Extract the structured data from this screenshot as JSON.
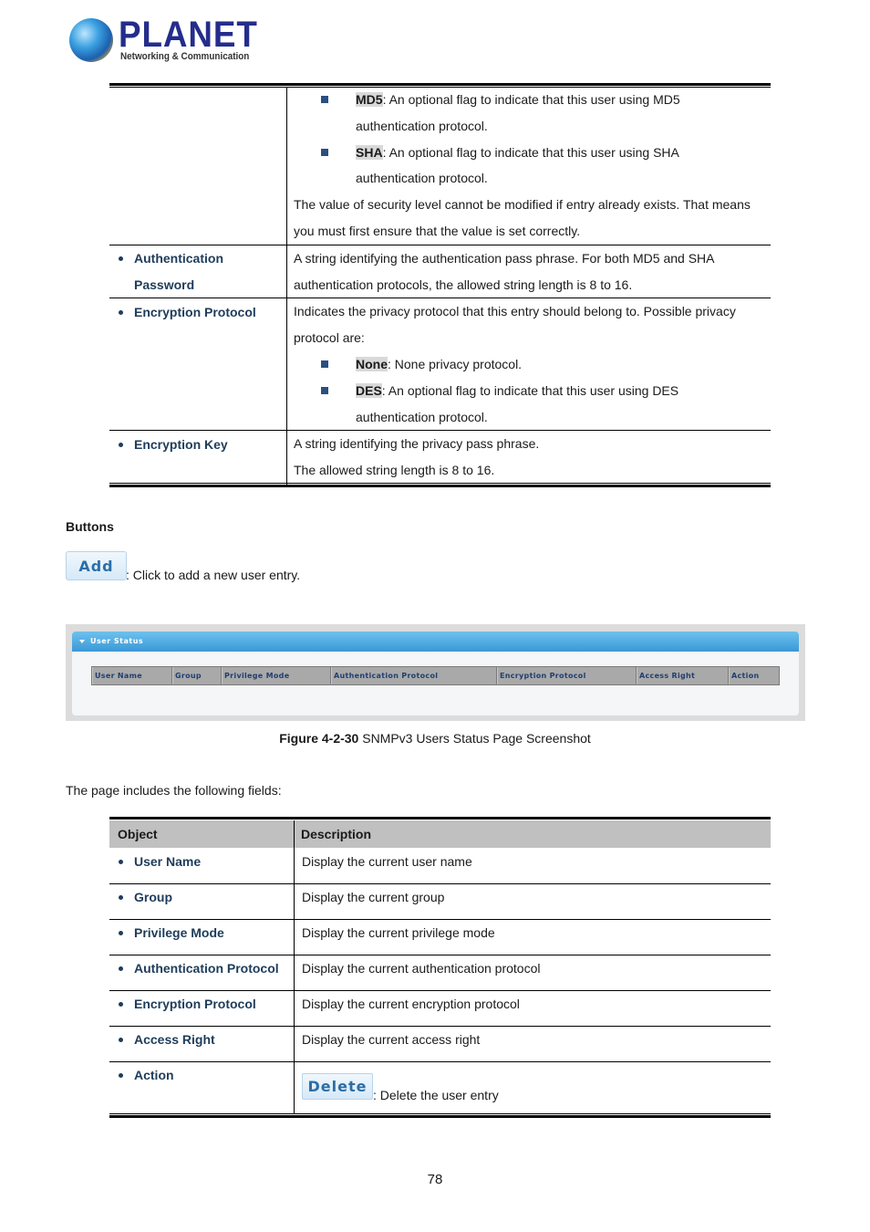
{
  "logo": {
    "brand": "PLANET",
    "tagline": "Networking & Communication"
  },
  "table1": {
    "continued_row": {
      "items": [
        {
          "flag": "MD5",
          "text": ": An optional flag to indicate that this user using MD5",
          "cont": "authentication protocol."
        },
        {
          "flag": "SHA",
          "text": ": An optional flag to indicate that this user using SHA",
          "cont": "authentication protocol."
        }
      ],
      "note_line1": "The value of security level cannot be modified if entry already exists. That means",
      "note_line2": "you must first ensure that the value is set correctly."
    },
    "rows": [
      {
        "object_line1": "Authentication",
        "object_line2": "Password",
        "desc_line1": "A string identifying the authentication pass phrase. For both MD5 and SHA",
        "desc_line2": "authentication protocols, the allowed string length is 8 to 16."
      },
      {
        "object": "Encryption Protocol",
        "desc_line1": "Indicates the privacy protocol that this entry should belong to. Possible privacy",
        "desc_line2": "protocol are:",
        "items": [
          {
            "flag": "None",
            "text": ": None privacy protocol.",
            "cont": ""
          },
          {
            "flag": "DES",
            "text": ": An optional flag to indicate that this user using DES",
            "cont": "authentication protocol."
          }
        ]
      },
      {
        "object": "Encryption Key",
        "desc_line1": "A string identifying the privacy pass phrase.",
        "desc_line2": "The allowed string length is 8 to 16."
      }
    ]
  },
  "buttons_section": {
    "heading": "Buttons",
    "add_label": "Add",
    "add_desc": ": Click to add a new user entry."
  },
  "screenshot": {
    "panel_title": "User Status",
    "columns": [
      "User Name",
      "Group",
      "Privilege Mode",
      "Authentication Protocol",
      "Encryption Protocol",
      "Access Right",
      "Action"
    ]
  },
  "caption": {
    "bold": "Figure 4-2-30",
    "text": " SNMPv3 Users Status Page Screenshot"
  },
  "intro": "The page includes the following fields:",
  "table2": {
    "header": {
      "object": "Object",
      "description": "Description"
    },
    "rows": [
      {
        "object": "User Name",
        "description": "Display the current user name"
      },
      {
        "object": "Group",
        "description": "Display the current group"
      },
      {
        "object": "Privilege Mode",
        "description": "Display the current privilege mode"
      },
      {
        "object": "Authentication Protocol",
        "description": "Display the current authentication protocol"
      },
      {
        "object": "Encryption Protocol",
        "description": "Display the current encryption protocol"
      },
      {
        "object": "Access Right",
        "description": "Display the current access right"
      },
      {
        "object": "Action",
        "delete_label": "Delete",
        "description": ": Delete the user entry"
      }
    ]
  },
  "page_number": "78",
  "colors": {
    "object_label": "#1e3c5a",
    "square_bullet": "#2a4f82",
    "flag_highlight": "#d9d9d9",
    "header_bg": "#c0c0c0",
    "panel_header": "#4ea9e0",
    "button_text": "#2d6ea6"
  }
}
